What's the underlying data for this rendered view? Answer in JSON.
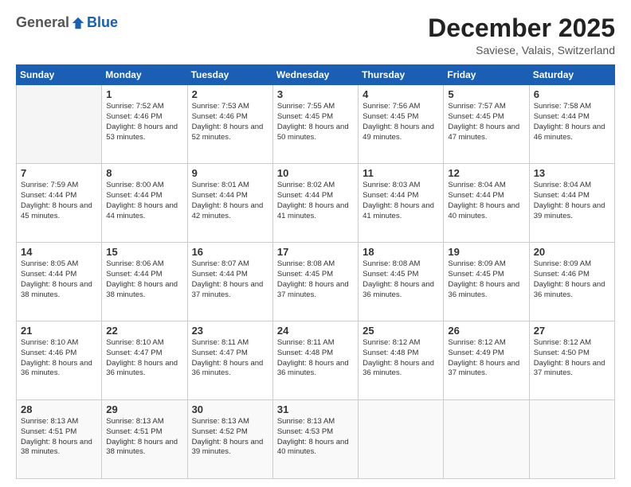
{
  "header": {
    "logo": {
      "general": "General",
      "blue": "Blue"
    },
    "title": "December 2025",
    "location": "Saviese, Valais, Switzerland"
  },
  "days_of_week": [
    "Sunday",
    "Monday",
    "Tuesday",
    "Wednesday",
    "Thursday",
    "Friday",
    "Saturday"
  ],
  "weeks": [
    [
      {
        "day": "",
        "empty": true
      },
      {
        "day": "1",
        "sunrise": "Sunrise: 7:52 AM",
        "sunset": "Sunset: 4:46 PM",
        "daylight": "Daylight: 8 hours and 53 minutes."
      },
      {
        "day": "2",
        "sunrise": "Sunrise: 7:53 AM",
        "sunset": "Sunset: 4:46 PM",
        "daylight": "Daylight: 8 hours and 52 minutes."
      },
      {
        "day": "3",
        "sunrise": "Sunrise: 7:55 AM",
        "sunset": "Sunset: 4:45 PM",
        "daylight": "Daylight: 8 hours and 50 minutes."
      },
      {
        "day": "4",
        "sunrise": "Sunrise: 7:56 AM",
        "sunset": "Sunset: 4:45 PM",
        "daylight": "Daylight: 8 hours and 49 minutes."
      },
      {
        "day": "5",
        "sunrise": "Sunrise: 7:57 AM",
        "sunset": "Sunset: 4:45 PM",
        "daylight": "Daylight: 8 hours and 47 minutes."
      },
      {
        "day": "6",
        "sunrise": "Sunrise: 7:58 AM",
        "sunset": "Sunset: 4:44 PM",
        "daylight": "Daylight: 8 hours and 46 minutes."
      }
    ],
    [
      {
        "day": "7",
        "sunrise": "Sunrise: 7:59 AM",
        "sunset": "Sunset: 4:44 PM",
        "daylight": "Daylight: 8 hours and 45 minutes."
      },
      {
        "day": "8",
        "sunrise": "Sunrise: 8:00 AM",
        "sunset": "Sunset: 4:44 PM",
        "daylight": "Daylight: 8 hours and 44 minutes."
      },
      {
        "day": "9",
        "sunrise": "Sunrise: 8:01 AM",
        "sunset": "Sunset: 4:44 PM",
        "daylight": "Daylight: 8 hours and 42 minutes."
      },
      {
        "day": "10",
        "sunrise": "Sunrise: 8:02 AM",
        "sunset": "Sunset: 4:44 PM",
        "daylight": "Daylight: 8 hours and 41 minutes."
      },
      {
        "day": "11",
        "sunrise": "Sunrise: 8:03 AM",
        "sunset": "Sunset: 4:44 PM",
        "daylight": "Daylight: 8 hours and 41 minutes."
      },
      {
        "day": "12",
        "sunrise": "Sunrise: 8:04 AM",
        "sunset": "Sunset: 4:44 PM",
        "daylight": "Daylight: 8 hours and 40 minutes."
      },
      {
        "day": "13",
        "sunrise": "Sunrise: 8:04 AM",
        "sunset": "Sunset: 4:44 PM",
        "daylight": "Daylight: 8 hours and 39 minutes."
      }
    ],
    [
      {
        "day": "14",
        "sunrise": "Sunrise: 8:05 AM",
        "sunset": "Sunset: 4:44 PM",
        "daylight": "Daylight: 8 hours and 38 minutes."
      },
      {
        "day": "15",
        "sunrise": "Sunrise: 8:06 AM",
        "sunset": "Sunset: 4:44 PM",
        "daylight": "Daylight: 8 hours and 38 minutes."
      },
      {
        "day": "16",
        "sunrise": "Sunrise: 8:07 AM",
        "sunset": "Sunset: 4:44 PM",
        "daylight": "Daylight: 8 hours and 37 minutes."
      },
      {
        "day": "17",
        "sunrise": "Sunrise: 8:08 AM",
        "sunset": "Sunset: 4:45 PM",
        "daylight": "Daylight: 8 hours and 37 minutes."
      },
      {
        "day": "18",
        "sunrise": "Sunrise: 8:08 AM",
        "sunset": "Sunset: 4:45 PM",
        "daylight": "Daylight: 8 hours and 36 minutes."
      },
      {
        "day": "19",
        "sunrise": "Sunrise: 8:09 AM",
        "sunset": "Sunset: 4:45 PM",
        "daylight": "Daylight: 8 hours and 36 minutes."
      },
      {
        "day": "20",
        "sunrise": "Sunrise: 8:09 AM",
        "sunset": "Sunset: 4:46 PM",
        "daylight": "Daylight: 8 hours and 36 minutes."
      }
    ],
    [
      {
        "day": "21",
        "sunrise": "Sunrise: 8:10 AM",
        "sunset": "Sunset: 4:46 PM",
        "daylight": "Daylight: 8 hours and 36 minutes."
      },
      {
        "day": "22",
        "sunrise": "Sunrise: 8:10 AM",
        "sunset": "Sunset: 4:47 PM",
        "daylight": "Daylight: 8 hours and 36 minutes."
      },
      {
        "day": "23",
        "sunrise": "Sunrise: 8:11 AM",
        "sunset": "Sunset: 4:47 PM",
        "daylight": "Daylight: 8 hours and 36 minutes."
      },
      {
        "day": "24",
        "sunrise": "Sunrise: 8:11 AM",
        "sunset": "Sunset: 4:48 PM",
        "daylight": "Daylight: 8 hours and 36 minutes."
      },
      {
        "day": "25",
        "sunrise": "Sunrise: 8:12 AM",
        "sunset": "Sunset: 4:48 PM",
        "daylight": "Daylight: 8 hours and 36 minutes."
      },
      {
        "day": "26",
        "sunrise": "Sunrise: 8:12 AM",
        "sunset": "Sunset: 4:49 PM",
        "daylight": "Daylight: 8 hours and 37 minutes."
      },
      {
        "day": "27",
        "sunrise": "Sunrise: 8:12 AM",
        "sunset": "Sunset: 4:50 PM",
        "daylight": "Daylight: 8 hours and 37 minutes."
      }
    ],
    [
      {
        "day": "28",
        "sunrise": "Sunrise: 8:13 AM",
        "sunset": "Sunset: 4:51 PM",
        "daylight": "Daylight: 8 hours and 38 minutes."
      },
      {
        "day": "29",
        "sunrise": "Sunrise: 8:13 AM",
        "sunset": "Sunset: 4:51 PM",
        "daylight": "Daylight: 8 hours and 38 minutes."
      },
      {
        "day": "30",
        "sunrise": "Sunrise: 8:13 AM",
        "sunset": "Sunset: 4:52 PM",
        "daylight": "Daylight: 8 hours and 39 minutes."
      },
      {
        "day": "31",
        "sunrise": "Sunrise: 8:13 AM",
        "sunset": "Sunset: 4:53 PM",
        "daylight": "Daylight: 8 hours and 40 minutes."
      },
      {
        "day": "",
        "empty": true
      },
      {
        "day": "",
        "empty": true
      },
      {
        "day": "",
        "empty": true
      }
    ]
  ]
}
